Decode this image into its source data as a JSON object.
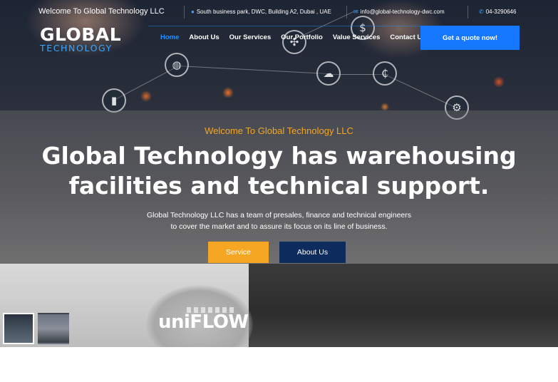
{
  "topbar": {
    "welcome": "Welcome To Global Technology LLC",
    "address": "South business park, DWC, Building A2, Dubai , UAE",
    "email": "info@global-technology-dwc.com",
    "phone": "04-3290646"
  },
  "logo": {
    "main": "GLOBAL",
    "sub": "TECHNOLOGY"
  },
  "nav": {
    "items": [
      {
        "label": "Home"
      },
      {
        "label": "About Us"
      },
      {
        "label": "Our Services"
      },
      {
        "label": "Our Portfolio"
      },
      {
        "label": "Value Services"
      },
      {
        "label": "Contact Us"
      }
    ],
    "quote_button": "Get a quote now!"
  },
  "hero": {
    "subtitle": "Welcome To Global Technology LLC",
    "title_line1": "Global Technology has warehousing",
    "title_line2": "facilities and technical support.",
    "desc_line1": "Global Technology LLC has a team of presales, finance and technical engineers",
    "desc_line2": "to cover the market and to assure its focus on its line of business.",
    "service_button": "Service",
    "about_button": "About Us"
  },
  "gallery": {
    "brand_text": "uniFLOW"
  },
  "colors": {
    "accent_blue": "#1677ff",
    "accent_orange": "#f5a623",
    "navy": "#0d2b5c"
  }
}
